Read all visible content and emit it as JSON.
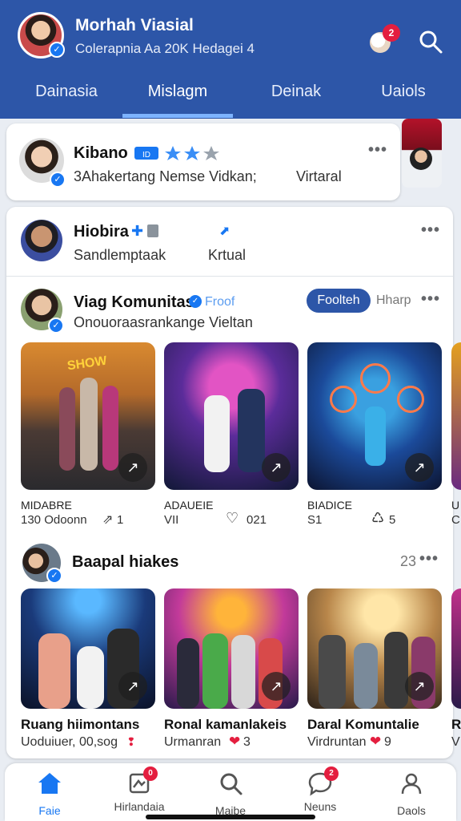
{
  "header": {
    "profile_name": "Morhah Viasial",
    "profile_sub": "Colerapnia Aa 20K Hedagei 4",
    "notification_count": "2",
    "tabs": [
      {
        "label": "Dainasia",
        "active": false
      },
      {
        "label": "Mislagm",
        "active": true
      },
      {
        "label": "Deinak",
        "active": false
      },
      {
        "label": "Uaiols",
        "active": false
      }
    ]
  },
  "card1": {
    "name": "Kibano",
    "sub": "3Ahakertang Nemse Vidkan;",
    "tag": "Virtaral",
    "more": "•••"
  },
  "card2": {
    "name": "Hiobira",
    "sub": "Sandlemptaak",
    "tag": "Krtual",
    "more": "•••"
  },
  "group": {
    "name": "Viag Komunitas",
    "badge_text": "Froof",
    "sub": "Onouoraasrankange Vieltan",
    "follow_label": "Foolteh",
    "share_label": "Hharp",
    "more": "•••",
    "thumbs": [
      {
        "title": "MIDABRE",
        "stat1": "130 Odoonn",
        "stat2": "1"
      },
      {
        "title": "ADAUEIE",
        "stat1": "VII",
        "stat2": "021"
      },
      {
        "title": "BIADICE",
        "stat1": "S1",
        "stat2": "5"
      },
      {
        "title": "U",
        "stat1": "C",
        "stat2": ""
      }
    ]
  },
  "section2": {
    "title": "Baapal hiakes",
    "count": "23",
    "more": "•••",
    "items": [
      {
        "title": "Ruang hiimontans",
        "sub": "Uoduiuer, 00,sog"
      },
      {
        "title": "Ronal kamanlakeis",
        "sub": "Urmanran"
      },
      {
        "title": "Daral Komuntalie",
        "sub": "Virdruntan"
      },
      {
        "title": "R",
        "sub": "V"
      }
    ],
    "item2_suffix": "3",
    "item3_suffix": "9"
  },
  "bottom_nav": [
    {
      "label": "Faie",
      "icon": "home-icon",
      "active": true
    },
    {
      "label": "Hirlandaia",
      "icon": "groups-icon",
      "badge": "0"
    },
    {
      "label": "Maibe",
      "icon": "search-icon"
    },
    {
      "label": "Neuns",
      "icon": "chat-icon",
      "badge": "2"
    },
    {
      "label": "Daols",
      "icon": "people-icon"
    }
  ],
  "colors": {
    "header_bg": "#2d56a8",
    "accent": "#1877f2",
    "badge": "#e41e3f"
  }
}
